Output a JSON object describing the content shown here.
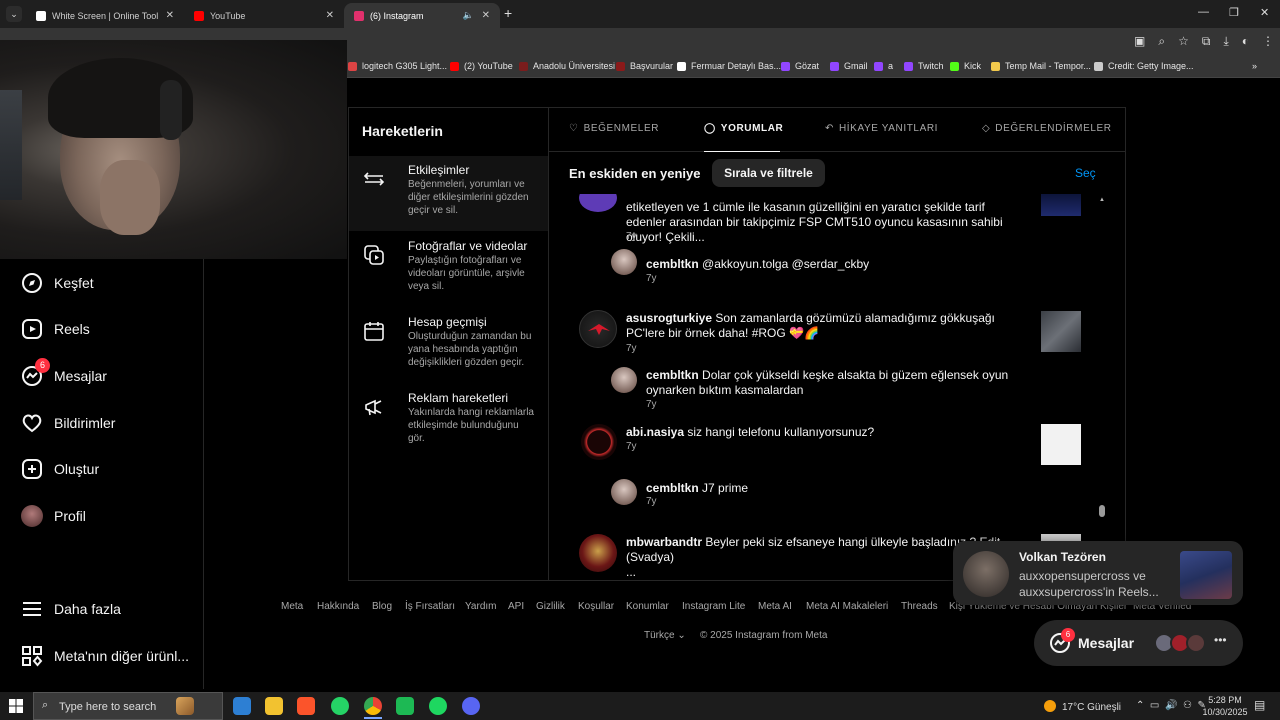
{
  "browser": {
    "tabs": [
      {
        "title": "White Screen | Online Tool",
        "favicon_color": "#ffffff"
      },
      {
        "title": "YouTube",
        "favicon_color": "#ff0000"
      },
      {
        "title": "(6) Instagram",
        "favicon_color": "#e1306c"
      }
    ],
    "bookmarks": [
      {
        "label": "logitech G305 Light...",
        "color": "#d44"
      },
      {
        "label": "(2) YouTube",
        "color": "#ff0000"
      },
      {
        "label": "Anadolu Üniversitesi",
        "color": "#7a1d1d"
      },
      {
        "label": "Başvurular",
        "color": "#8b1a1a"
      },
      {
        "label": "Fermuar Detaylı Bas...",
        "color": "#fff"
      },
      {
        "label": "Gözat",
        "color": "#9146ff"
      },
      {
        "label": "Gmail",
        "color": "#9146ff"
      },
      {
        "label": "a",
        "color": "#9146ff"
      },
      {
        "label": "Twitch",
        "color": "#9146ff"
      },
      {
        "label": "Kick",
        "color": "#53fc18"
      },
      {
        "label": "Temp Mail - Tempor...",
        "color": "#f2c94c"
      },
      {
        "label": "Credit: Getty Image...",
        "color": "#ccc"
      }
    ]
  },
  "nav": {
    "items": [
      {
        "label": "Keşfet",
        "icon": "compass-icon"
      },
      {
        "label": "Reels",
        "icon": "reels-icon"
      },
      {
        "label": "Mesajlar",
        "icon": "messenger-icon",
        "badge": "6"
      },
      {
        "label": "Bildirimler",
        "icon": "heart-icon"
      },
      {
        "label": "Oluştur",
        "icon": "plus-icon"
      },
      {
        "label": "Profil",
        "icon": "avatar"
      }
    ],
    "more": "Daha fazla",
    "meta_more": "Meta'nın diğer ürünl..."
  },
  "activity": {
    "title": "Hareketlerin",
    "options": [
      {
        "title": "Etkileşimler",
        "desc": "Beğenmeleri, yorumları ve diğer etkileşimlerini gözden geçir ve sil."
      },
      {
        "title": "Fotoğraflar ve videolar",
        "desc": "Paylaştığın fotoğrafları ve videoları görüntüle, arşivle veya sil."
      },
      {
        "title": "Hesap geçmişi",
        "desc": "Oluşturduğun zamandan bu yana hesabında yaptığın değişiklikleri gözden geçir."
      },
      {
        "title": "Reklam hareketleri",
        "desc": "Yakınlarda hangi reklamlarla etkileşimde bulunduğunu gör."
      }
    ],
    "tabs": [
      {
        "label": "BEĞENMELER",
        "icon": "♡"
      },
      {
        "label": "YORUMLAR",
        "icon": "◯"
      },
      {
        "label": "HİKAYE YANITLARI",
        "icon": "↶"
      },
      {
        "label": "DEĞERLENDİRMELER",
        "icon": "◇"
      }
    ],
    "sort_label": "En eskiden en yeniye",
    "sort_button": "Sırala ve filtrele",
    "select": "Seç"
  },
  "feed": {
    "posts": [
      {
        "user": "",
        "text": "etiketleyen ve 1 cümle ile kasanın güzelliğini en yaratıcı şekilde tarif edenler arasından bir takipçimiz FSP CMT510 oyuncu kasasının sahibi oluyor! Çekili...",
        "ago": "7y",
        "reply_user": "cembltkn",
        "reply_text": "@akkoyun.tolga @serdar_ckby",
        "reply_ago": "7y"
      },
      {
        "user": "asusrogturkiye",
        "text": "Son zamanlarda gözümüzü alamadığımız gökkuşağı PC'lere bir örnek daha! #ROG 💝🌈",
        "ago": "7y",
        "reply_user": "cembltkn",
        "reply_text": "Dolar çok yükseldi keşke alsakta bi güzem eğlensek oyun oynarken bıktım kasmalardan",
        "reply_ago": "7y"
      },
      {
        "user": "abi.nasiya",
        "text": "siz hangi telefonu kullanıyorsunuz?",
        "ago": "7y",
        "reply_user": "cembltkn",
        "reply_text": "J7 prime",
        "reply_ago": "7y"
      },
      {
        "user": "mbwarbandtr",
        "text": "Beyler peki siz efsaneye hangi ülkeyle başladınız ? Edit (Svadya)",
        "more": "...",
        "ago": "7y"
      }
    ]
  },
  "footer": {
    "links": [
      "Meta",
      "Hakkında",
      "Blog",
      "İş Fırsatları",
      "Yardım",
      "API",
      "Gizlilik",
      "Koşullar",
      "Konumlar",
      "Instagram Lite",
      "Meta AI",
      "Meta AI Makaleleri",
      "Threads",
      "Kişi Yükleme ve Hesabı Olmayan Kişiler",
      "Meta Verified"
    ],
    "language": "Türkçe",
    "copyright": "© 2025 Instagram from Meta"
  },
  "toast": {
    "name": "Volkan Tezören",
    "message": "auxxopensupercross ve auxxsupercross'in Reels..."
  },
  "messages_pill": {
    "label": "Mesajlar",
    "badge": "6"
  },
  "taskbar": {
    "search_placeholder": "Type here to search",
    "weather": "17°C  Güneşli",
    "time": "5:28 PM",
    "date": "10/30/2025"
  }
}
